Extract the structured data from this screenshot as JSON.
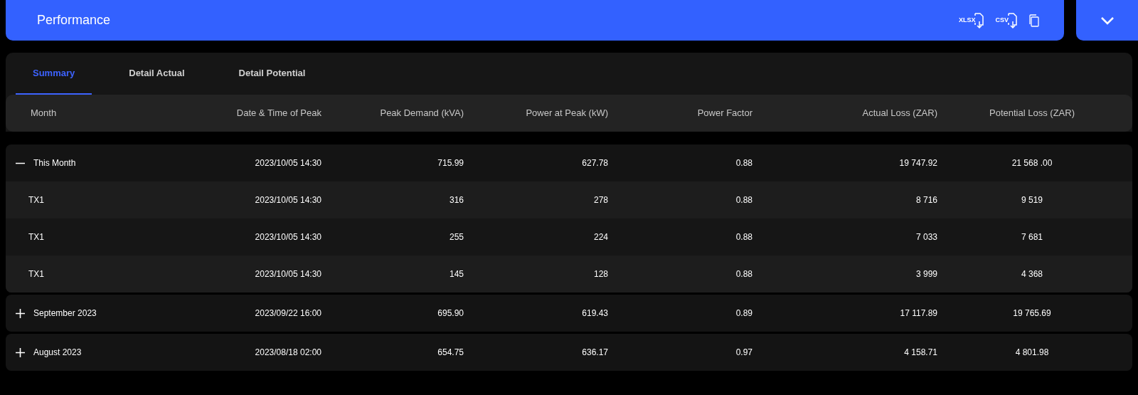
{
  "header": {
    "title": "Performance",
    "actions": [
      {
        "kind": "xlsx",
        "label": "XLSX"
      },
      {
        "kind": "csv",
        "label": "CSV"
      },
      {
        "kind": "copy"
      }
    ],
    "collapse_button": {
      "expanded": true
    }
  },
  "tabs": [
    {
      "label": "Summary",
      "selected": true
    },
    {
      "label": "Detail Actual",
      "selected": false
    },
    {
      "label": "Detail Potential",
      "selected": false
    }
  ],
  "table": {
    "columns": [
      "Month",
      "Date & Time of Peak",
      "Peak Demand (kVA)",
      "Power at Peak (kW)",
      "Power Factor",
      "Actual Loss (ZAR)",
      "Potential Loss (ZAR)"
    ],
    "groups": [
      {
        "cells": [
          "This Month",
          "2023/10/05 14:30",
          "715.99",
          "627.78",
          "0.88",
          "19 747.92",
          "21 568 .00"
        ],
        "expanded": true,
        "children": [
          {
            "cells": [
              "TX1",
              "2023/10/05 14:30",
              "316",
              "278",
              "0.88",
              "8 716",
              "9 519"
            ]
          },
          {
            "cells": [
              "TX1",
              "2023/10/05 14:30",
              "255",
              "224",
              "0.88",
              "7 033",
              "7 681"
            ]
          },
          {
            "cells": [
              "TX1",
              "2023/10/05 14:30",
              "145",
              "128",
              "0.88",
              "3 999",
              "4 368"
            ]
          }
        ]
      },
      {
        "cells": [
          "September 2023",
          "2023/09/22 16:00",
          "695.90",
          "619.43",
          "0.89",
          "17 117.89",
          "19 765.69"
        ],
        "expanded": false
      },
      {
        "cells": [
          "August 2023",
          "2023/08/18 02:00",
          "654.75",
          "636.17",
          "0.97",
          "4 158.71",
          "4 801.98"
        ],
        "expanded": false
      }
    ]
  }
}
